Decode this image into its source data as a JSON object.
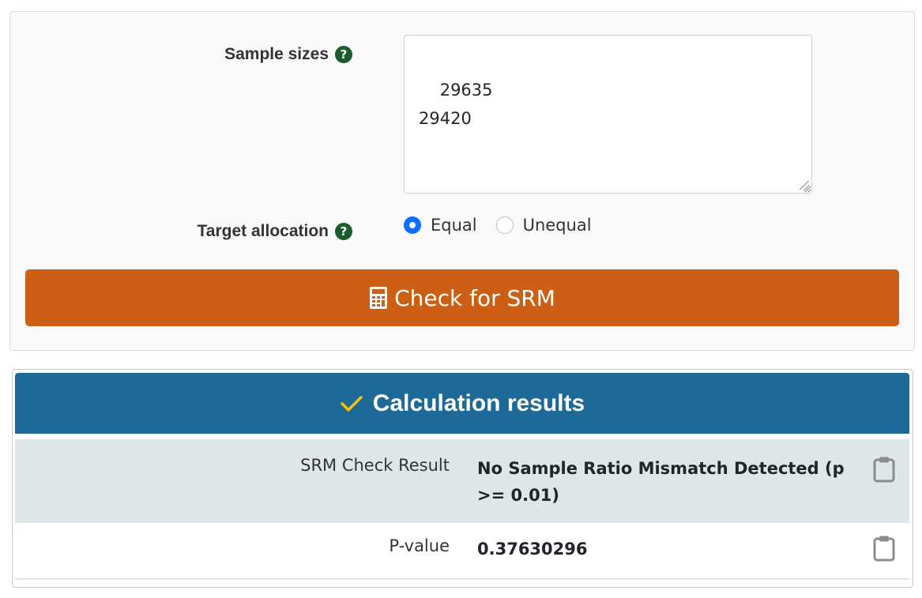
{
  "form": {
    "sample_sizes_label": "Sample sizes",
    "sample_sizes_value": "29635\n29420",
    "target_allocation_label": "Target allocation",
    "help_glyph": "?",
    "allocation_options": [
      {
        "label": "Equal",
        "selected": true
      },
      {
        "label": "Unequal",
        "selected": false
      }
    ],
    "submit_label": "Check for SRM",
    "submit_icon": "calculator-icon"
  },
  "results": {
    "title": "Calculation results",
    "title_icon": "checkmark-icon",
    "rows": [
      {
        "label": "SRM Check Result",
        "value": "No Sample Ratio Mismatch Detected (p >= 0.01)"
      },
      {
        "label": "P-value",
        "value": "0.37630296"
      }
    ]
  },
  "colors": {
    "button": "#cc5f13",
    "header": "#1d6998",
    "help_icon": "#1d5a2c",
    "radio_selected": "#0d6efd",
    "checkmark": "#f5c400",
    "row_highlight": "#dfe6e9"
  }
}
